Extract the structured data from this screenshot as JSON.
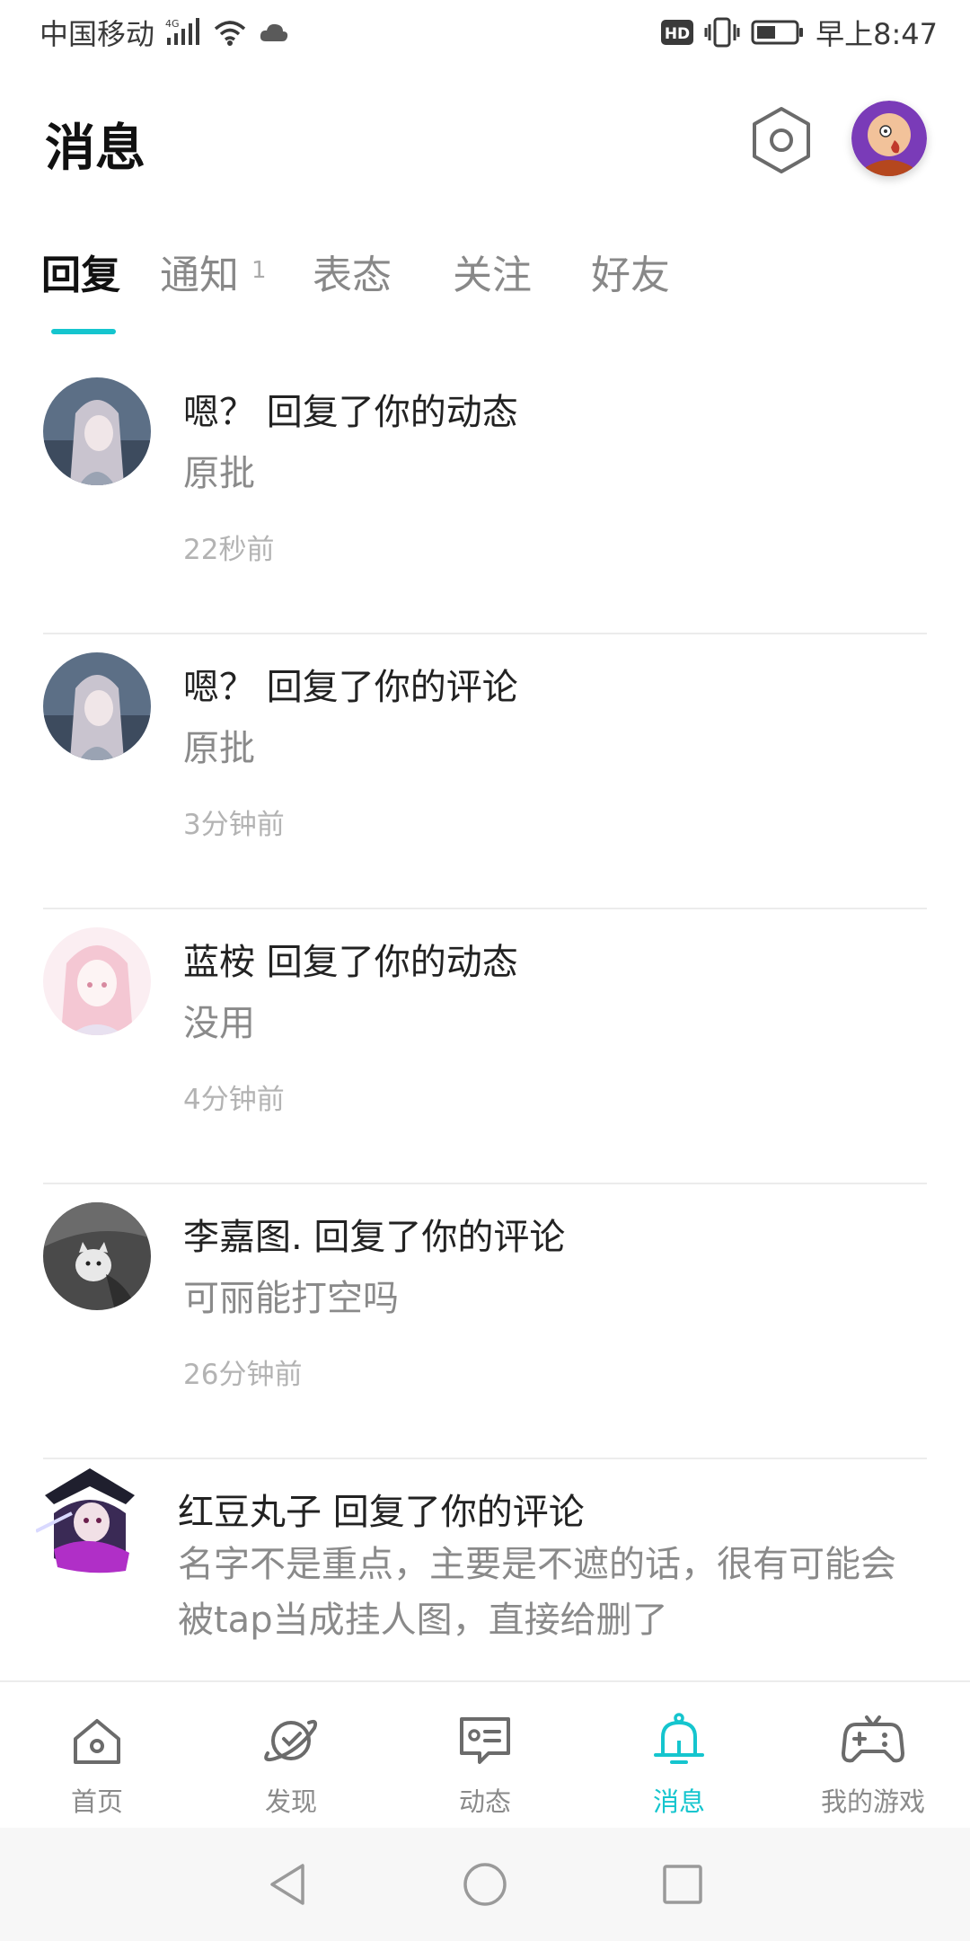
{
  "status_bar": {
    "carrier": "中国移动",
    "network": "4G",
    "hd": "HD",
    "time": "早上8:47"
  },
  "header": {
    "title": "消息"
  },
  "tabs": [
    {
      "label": "回复",
      "active": true
    },
    {
      "label": "通知",
      "badge": "1"
    },
    {
      "label": "表态"
    },
    {
      "label": "关注"
    },
    {
      "label": "好友"
    }
  ],
  "messages": [
    {
      "title": "嗯？ 回复了你的动态",
      "content": "原批",
      "time": "22秒前",
      "avatar": "anime-girl-gray"
    },
    {
      "title": "嗯？ 回复了你的评论",
      "content": "原批",
      "time": "3分钟前",
      "avatar": "anime-girl-gray"
    },
    {
      "title": "蓝桉 回复了你的动态",
      "content": "没用",
      "time": "4分钟前",
      "avatar": "anime-girl-pink"
    },
    {
      "title": "李嘉图. 回复了你的评论",
      "content": "可丽能打空吗",
      "time": "26分钟前",
      "avatar": "cat-photo"
    },
    {
      "title": "红豆丸子 回复了你的评论",
      "content": "名字不是重点，主要是不遮的话，很有可能会被tap当成挂人图，直接给删了",
      "avatar": "anime-character-purple"
    }
  ],
  "bottom_nav": [
    {
      "label": "首页",
      "icon": "home-icon"
    },
    {
      "label": "发现",
      "icon": "planet-icon"
    },
    {
      "label": "动态",
      "icon": "chat-icon"
    },
    {
      "label": "消息",
      "icon": "bell-icon",
      "active": true
    },
    {
      "label": "我的游戏",
      "icon": "gamepad-icon"
    }
  ],
  "colors": {
    "accent": "#15c5ce",
    "text_primary": "#222222",
    "text_secondary": "#8a8a8a",
    "text_time": "#b3b3b3"
  }
}
